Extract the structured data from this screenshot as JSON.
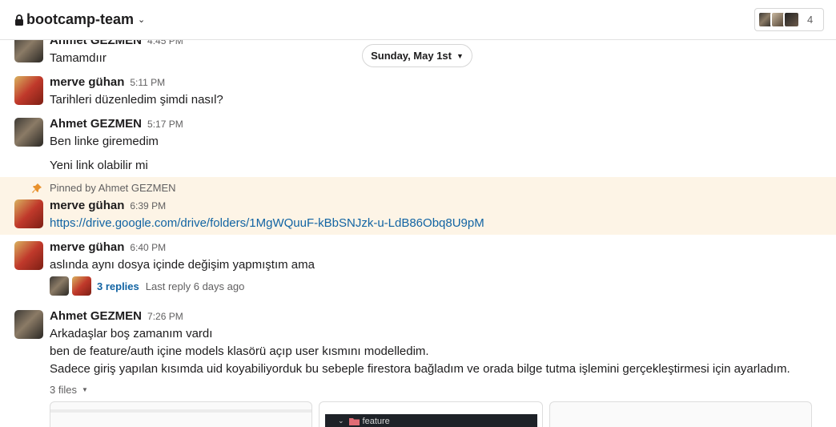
{
  "header": {
    "channel_name": "bootcamp-team",
    "member_count": "4"
  },
  "date_divider": "Sunday, May 1st",
  "messages": [
    {
      "author": "Ahmet GEZMEN",
      "time": "4:45 PM",
      "lines": [
        "Tamamdıır"
      ]
    },
    {
      "author": "merve gühan",
      "time": "5:11 PM",
      "lines": [
        "Tarihleri düzenledim şimdi nasıl?"
      ]
    },
    {
      "author": "Ahmet GEZMEN",
      "time": "5:17 PM",
      "lines": [
        "Ben linke giremedim",
        "Yeni link olabilir mi"
      ]
    },
    {
      "author": "merve gühan",
      "time": "6:39 PM",
      "pinned_by": "Pinned by Ahmet GEZMEN",
      "lines": [
        "https://drive.google.com/drive/folders/1MgWQuuF-kBbSNJzk-u-LdB86Obq8U9pM"
      ]
    },
    {
      "author": "merve gühan",
      "time": "6:40 PM",
      "lines": [
        "aslında aynı dosya içinde değişim yapmıştım ama"
      ],
      "thread": {
        "replies": "3 replies",
        "last_reply": "Last reply 6 days ago"
      }
    },
    {
      "author": "Ahmet GEZMEN",
      "time": "7:26 PM",
      "lines": [
        "Arkadaşlar boş zamanım vardı",
        "ben de feature/auth içine models klasörü açıp user kısmını modelledim.",
        "Sadece giriş yapılan kısımda uid koyabiliyorduk bu sebeple firestora bağladım ve orada bilge tutma işlemini gerçekleştirmesi için ayarladım."
      ],
      "files_label": "3 files",
      "file_preview_folder": "feature"
    }
  ],
  "colors": {
    "link": "#1264a3",
    "pinned_background": "#fdf4e6",
    "pin_icon": "#e8912d"
  }
}
